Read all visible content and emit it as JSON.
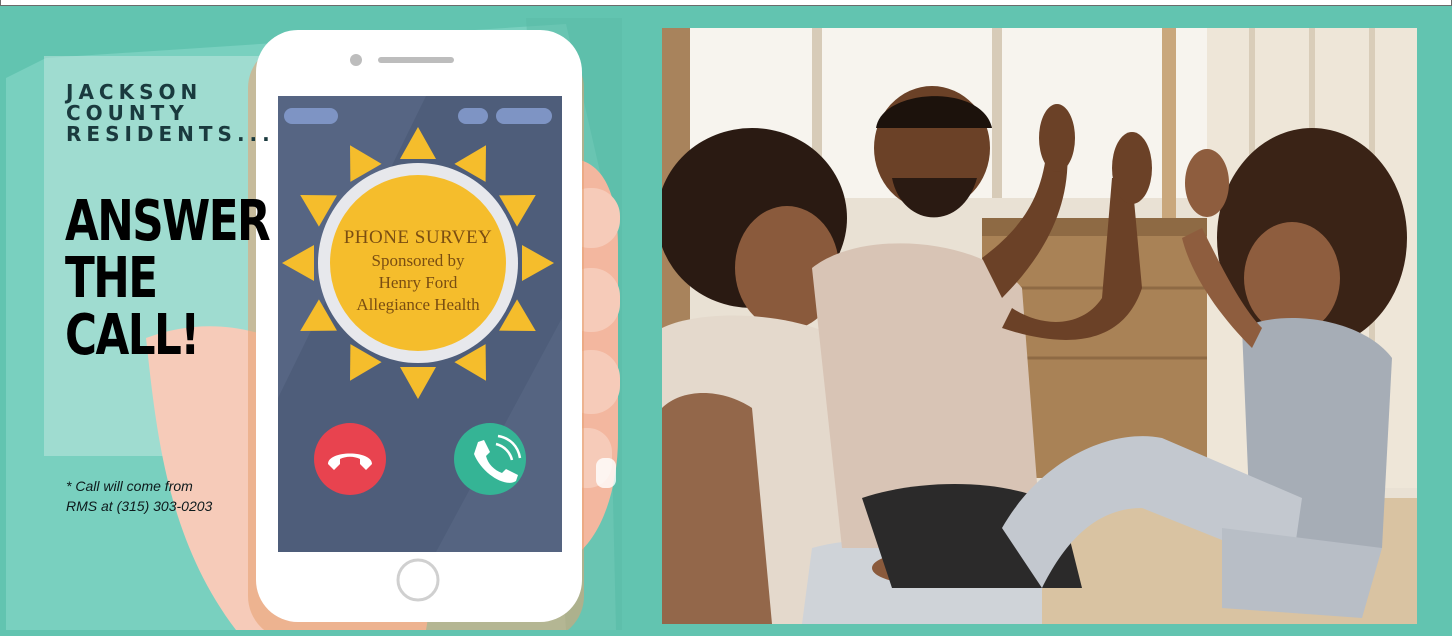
{
  "flyer": {
    "tagline_lines": [
      "JACKSON",
      "COUNTY",
      "RESIDENTS..."
    ],
    "headline_lines": [
      "ANSWER",
      "THE",
      "CALL!"
    ],
    "note_lines": [
      "* Call will come from",
      "RMS at (315) 303-0203"
    ],
    "sun": {
      "title": "PHONE SURVEY",
      "lines": [
        "Sponsored by",
        "Henry Ford",
        "Allegiance Health"
      ]
    }
  },
  "colors": {
    "background": "#62c4b0",
    "sun": "#f5bd2c",
    "decline": "#e8434f",
    "accept": "#35b495",
    "screen": "#4e5d7a"
  },
  "icons": [
    "decline-call-icon",
    "accept-call-icon",
    "sun-icon",
    "phone-handset-icon"
  ]
}
